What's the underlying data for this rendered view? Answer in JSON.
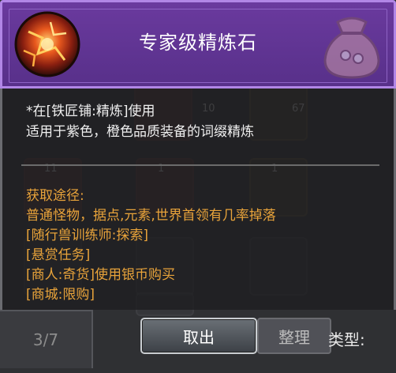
{
  "item": {
    "title": "专家级精炼石",
    "description": [
      "*在[铁匠铺:精炼]使用",
      "适用于紫色，橙色品质装备的词缀精炼"
    ],
    "source_lines": [
      "获取途径:",
      "普通怪物，据点,元素,世界首领有几率掉落",
      "[随行兽训练师:探索]",
      "[悬赏任务]",
      "[商人:奇货]使用银币购买",
      "[商城:限购]"
    ],
    "icon": "refine-stone-icon"
  },
  "buttons": {
    "cancel": "取出",
    "sort": "整理"
  },
  "inventory": {
    "page": "3/7",
    "type_label": "类型:",
    "slot_counts": [
      "10",
      "67",
      "11",
      "1",
      "1"
    ]
  },
  "colors": {
    "header": "#5f3492",
    "header_border": "#b186e6",
    "source_text": "#e8a33a",
    "desc_text": "#f0f0f0"
  }
}
